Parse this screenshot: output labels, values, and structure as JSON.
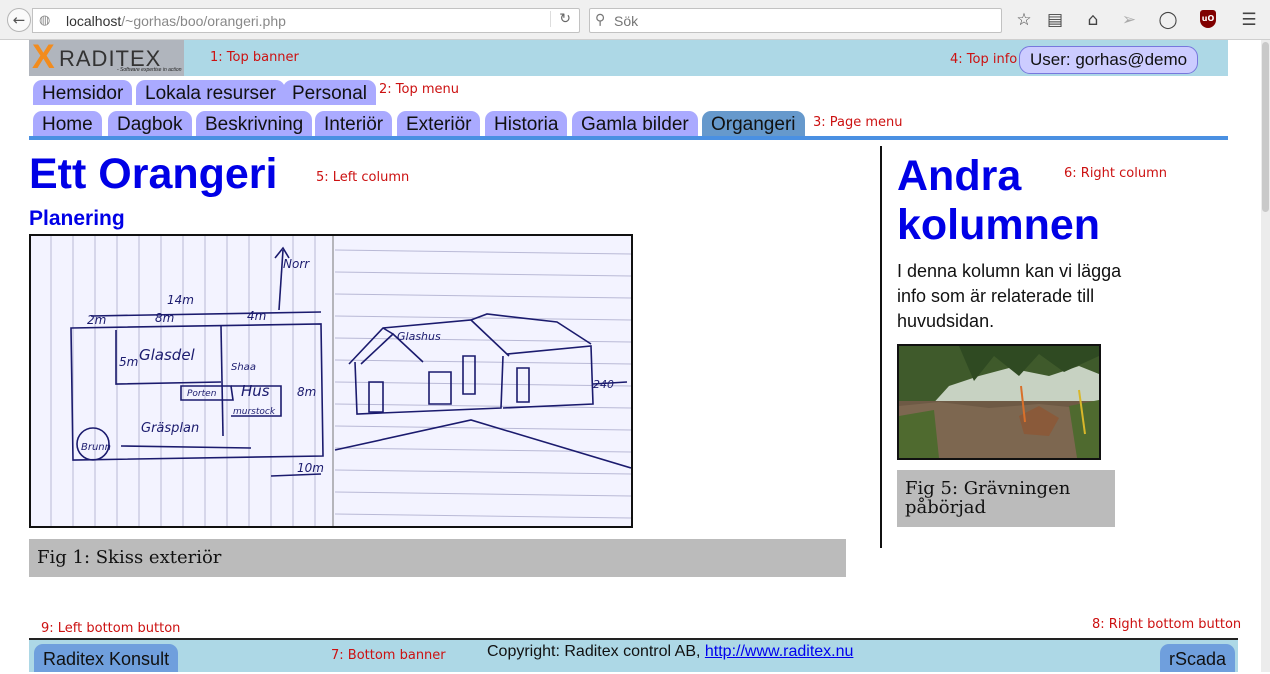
{
  "browser": {
    "url_host": "localhost",
    "url_path": "/~gorhas/boo/orangeri.php",
    "search_placeholder": "Sök"
  },
  "top_banner": {
    "logo_text": "RADITEX",
    "logo_letter": "X",
    "logo_tagline": "- Software expertise in action",
    "label": "1: Top banner"
  },
  "top_info": {
    "label": "4: Top info",
    "user": "User: gorhas@demo"
  },
  "top_menu": {
    "label": "2: Top menu",
    "items": [
      "Hemsidor",
      "Lokala resurser",
      "Personal"
    ]
  },
  "page_menu": {
    "label": "3: Page menu",
    "items": [
      "Home",
      "Dagbok",
      "Beskrivning",
      "Interiör",
      "Exteriör",
      "Historia",
      "Gamla bilder",
      "Organgeri"
    ],
    "active": "Organgeri"
  },
  "left_column": {
    "label": "5: Left column",
    "title": "Ett Orangeri",
    "subtitle": "Planering",
    "sketch_labels": {
      "north": "Norr",
      "dim_14m": "14m",
      "dim_2m": "2m",
      "dim_8m": "8m",
      "dim_4m": "4m",
      "dim_5m": "5m",
      "dim_8m_side": "8m",
      "dim_10m": "10m",
      "glasdel": "Glasdel",
      "hus": "Hus",
      "gras": "Gräsplan",
      "brunn": "Brunn",
      "glashus": "Glashus",
      "dim_240": "240",
      "mur": "murstock",
      "shaa": "Shaa",
      "porten": "Porten"
    },
    "caption": "Fig 1: Skiss exteriör"
  },
  "right_column": {
    "label": "6: Right column",
    "title_line1": "Andra",
    "title_line2": "kolumnen",
    "text": "I denna kolumn kan vi lägga info som är relaterade till huvudsidan.",
    "caption": "Fig 5: Grävningen påbörjad"
  },
  "bottom": {
    "banner_label": "7: Bottom banner",
    "right_button_label": "8: Right bottom button",
    "left_button_label": "9: Left bottom button",
    "copyright_text": "Copyright: Raditex control AB, ",
    "copyright_link": "http://www.raditex.nu",
    "left_button": "Raditex Konsult",
    "right_button": "rScada"
  }
}
